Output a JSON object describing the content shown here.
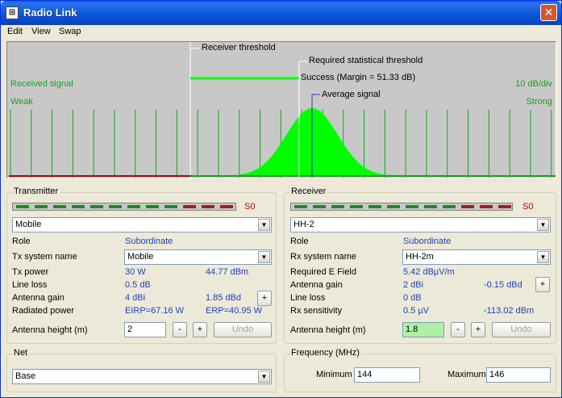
{
  "window": {
    "title": "Radio Link"
  },
  "menu": [
    "Edit",
    "View",
    "Swap"
  ],
  "graph": {
    "received_signal": "Received signal",
    "weak": "Weak",
    "strong": "Strong",
    "scale": "10 dB/div",
    "receiver_threshold": "Receiver threshold",
    "statistical_threshold": "Required statistical threshold",
    "success": "Success (Margin = 51.33 dB)",
    "average_signal": "Average signal",
    "colors": {
      "signal": "#00ff00",
      "threshold": "#c00000",
      "grid": "#17a317"
    }
  },
  "transmitter": {
    "title": "Transmitter",
    "meter_value": "S0",
    "mode": "Mobile",
    "role_label": "Role",
    "role_value": "Subordinate",
    "tx_system_label": "Tx system name",
    "tx_system_value": "Mobile",
    "tx_power_label": "Tx power",
    "tx_power_w": "30 W",
    "tx_power_dbm": "44.77 dBm",
    "line_loss_label": "Line loss",
    "line_loss_value": "0.5 dB",
    "antenna_gain_label": "Antenna gain",
    "antenna_gain_dbi": "4 dBi",
    "antenna_gain_dbd": "1.85 dBd",
    "radiated_power_label": "Radiated power",
    "eirp": "EIRP=67.16 W",
    "erp": "ERP=40.95 W",
    "antenna_height_label": "Antenna height (m)",
    "antenna_height_value": "2",
    "minus": "-",
    "plus": "+",
    "undo": "Undo"
  },
  "receiver": {
    "title": "Receiver",
    "meter_value": "S0",
    "mode": "HH-2",
    "role_label": "Role",
    "role_value": "Subordinate",
    "rx_system_label": "Rx system name",
    "rx_system_value": "HH-2m",
    "required_field_label": "Required E Field",
    "required_field_value": "5.42 dBµV/m",
    "antenna_gain_label": "Antenna gain",
    "antenna_gain_dbi": "2 dBi",
    "antenna_gain_dbd": "-0.15 dBd",
    "line_loss_label": "Line loss",
    "line_loss_value": "0 dB",
    "sensitivity_label": "Rx sensitivity",
    "sensitivity_uv": "0.5 µV",
    "sensitivity_dbm": "-113.02 dBm",
    "antenna_height_label": "Antenna height (m)",
    "antenna_height_value": "1.8",
    "minus": "-",
    "plus": "+",
    "undo": "Undo"
  },
  "net": {
    "title": "Net",
    "value": "Base"
  },
  "frequency": {
    "title": "Frequency (MHz)",
    "min_label": "Minimum",
    "min_value": "144",
    "max_label": "Maximum",
    "max_value": "146"
  }
}
